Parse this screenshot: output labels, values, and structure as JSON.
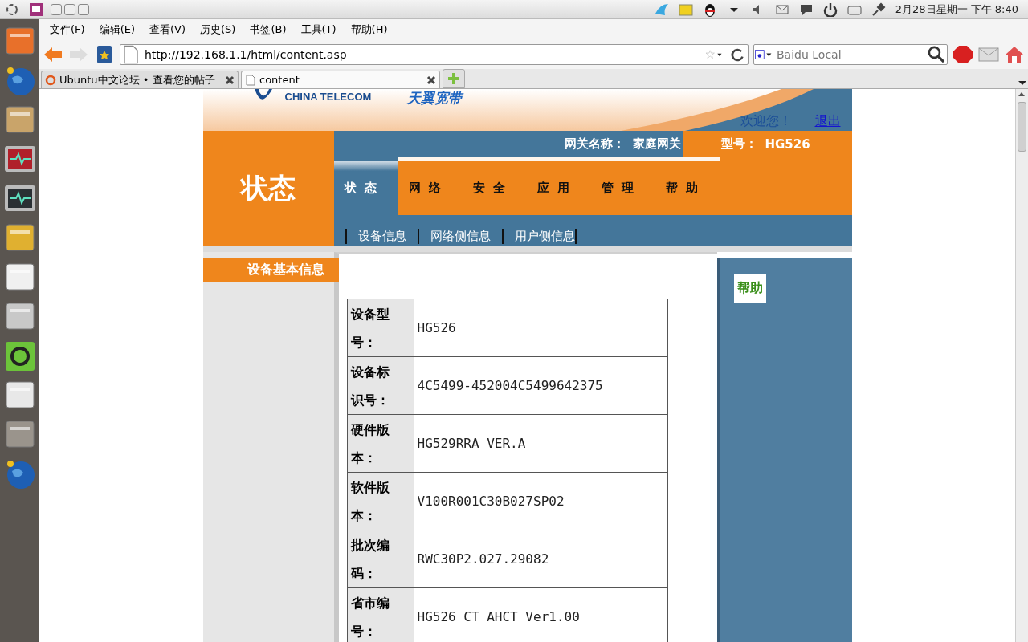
{
  "desktop_panel": {
    "clock": "2月28日星期一 下午  8:40"
  },
  "browser": {
    "menu": [
      "文件(F)",
      "编辑(E)",
      "查看(V)",
      "历史(S)",
      "书签(B)",
      "工具(T)",
      "帮助(H)"
    ],
    "address": "http://192.168.1.1/html/content.asp",
    "search_placeholder": "Baidu Local",
    "tabs": [
      {
        "label": "Ubuntu中文论坛 • 查看您的帖子",
        "selected": false
      },
      {
        "label": "content",
        "selected": true
      }
    ]
  },
  "router_page": {
    "brand": "CHINA TELECOM",
    "product": "天翼宽带",
    "welcome": "欢迎您！",
    "logout": "退出",
    "section_title": "状态",
    "gateway_label": "网关名称：",
    "gateway_name": "家庭网关",
    "model_label": "型号：",
    "model": "HG526",
    "nav_tabs": [
      {
        "label": "状态",
        "selected": true
      },
      {
        "label": "网络",
        "selected": false
      },
      {
        "label": "安全",
        "selected": false
      },
      {
        "label": "应用",
        "selected": false
      },
      {
        "label": "管理",
        "selected": false
      },
      {
        "label": "帮助",
        "selected": false
      }
    ],
    "sub_nav": [
      "设备信息",
      "网络侧信息",
      "用户侧信息"
    ],
    "sidebar": [
      {
        "label": "设备基本信息",
        "selected": true
      }
    ],
    "help": "帮助",
    "info_table": [
      {
        "label": "设备型号：",
        "value": "HG526"
      },
      {
        "label": "设备标识号：",
        "value": "4C5499-452004C5499642375"
      },
      {
        "label": "硬件版本：",
        "value": "HG529RRA VER.A"
      },
      {
        "label": "软件版本：",
        "value": "V100R001C30B027SP02"
      },
      {
        "label": "批次编码：",
        "value": "RWC30P2.027.29082"
      },
      {
        "label": "省市编号：",
        "value": "HG526_CT_AHCT_Ver1.00"
      }
    ]
  }
}
